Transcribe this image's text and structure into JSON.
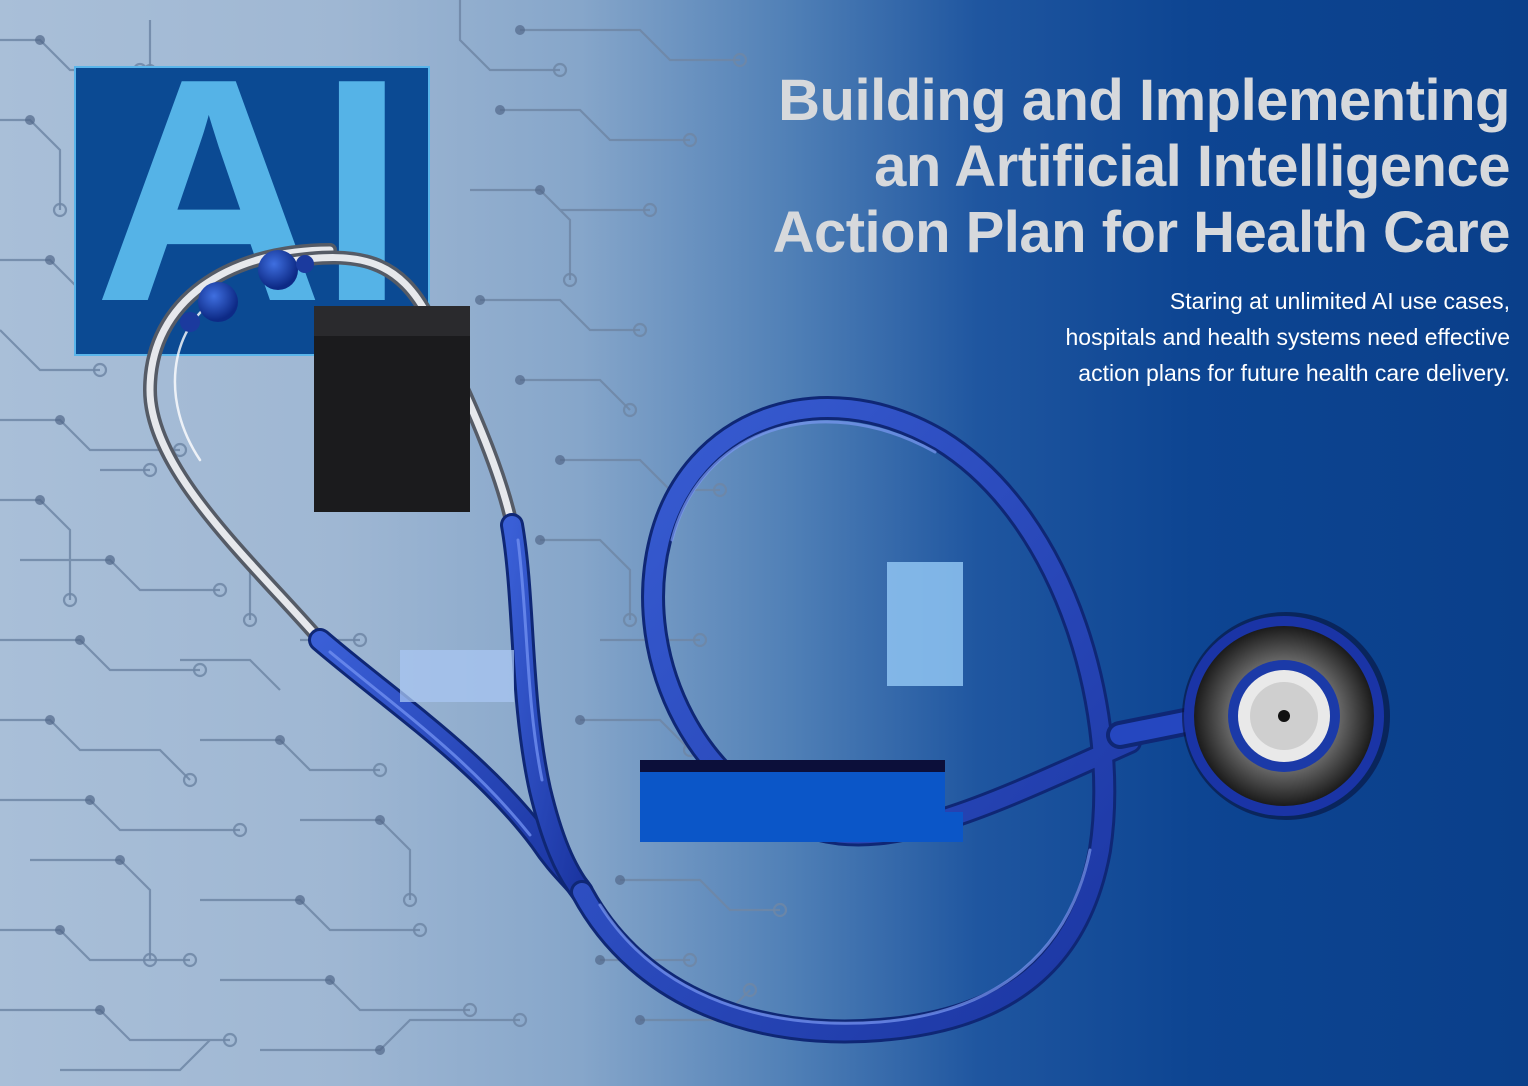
{
  "badge": {
    "text": "AI"
  },
  "headline": {
    "lines": [
      "Building and Implementing",
      "an Artificial Intelligence",
      "Action Plan for Health Care"
    ]
  },
  "subhead": {
    "lines": [
      "Staring at unlimited AI use cases,",
      "hospitals and health systems need effective",
      "action plans for future health care delivery."
    ]
  },
  "colors": {
    "background_light": "#a9bfd8",
    "background_dark": "#0a3f8a",
    "badge_fill": "#0b4a93",
    "badge_letters": "#55b3e7",
    "headline": "#d7d9dc",
    "subhead": "#ffffff",
    "tubing": "#1e3fb0"
  }
}
